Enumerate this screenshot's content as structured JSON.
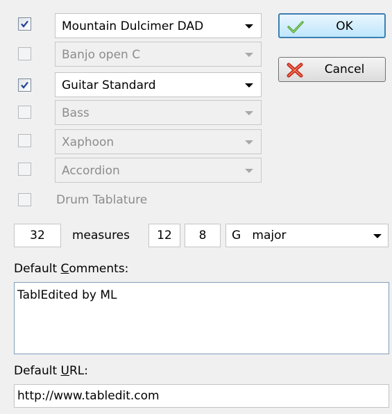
{
  "instruments": [
    {
      "label": "Mountain Dulcimer DAD",
      "checked": true,
      "enabled": true
    },
    {
      "label": "Banjo open C",
      "checked": false,
      "enabled": false
    },
    {
      "label": "Guitar Standard",
      "checked": true,
      "enabled": true
    },
    {
      "label": "Bass",
      "checked": false,
      "enabled": false
    },
    {
      "label": "Xaphoon",
      "checked": false,
      "enabled": false
    },
    {
      "label": "Accordion",
      "checked": false,
      "enabled": false
    }
  ],
  "drum": {
    "label": "Drum Tablature",
    "checked": false
  },
  "buttons": {
    "ok": "OK",
    "cancel": "Cancel"
  },
  "measures": {
    "count": "32",
    "label": "measures",
    "time_num": "12",
    "time_den": "8",
    "key": "G   major"
  },
  "comments": {
    "label_pre": "Default ",
    "label_underline": "C",
    "label_post": "omments:",
    "value": "TablEdited by ML"
  },
  "url": {
    "label_pre": "Default ",
    "label_underline": "U",
    "label_post": "RL:",
    "value": "http://www.tabledit.com"
  }
}
